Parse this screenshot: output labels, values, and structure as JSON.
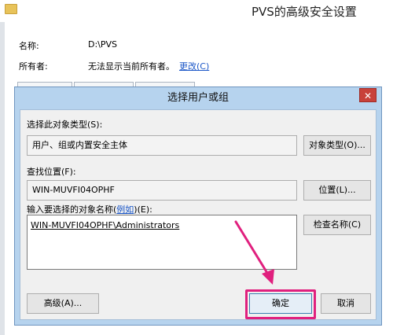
{
  "background_window": {
    "title": "PVS的高级安全设置",
    "name_label": "名称:",
    "name_value": "D:\\PVS",
    "owner_label": "所有者:",
    "owner_value": "无法显示当前所有者。",
    "change_link": "更改(C)"
  },
  "dialog": {
    "title": "选择用户或组",
    "close_glyph": "✕",
    "object_type_label": "选择此对象类型(S):",
    "object_type_value": "用户、组或内置安全主体",
    "object_type_button": "对象类型(O)...",
    "location_label": "查找位置(F):",
    "location_value": "WIN-MUVFI04OPHF",
    "location_button": "位置(L)...",
    "names_label_prefix": "输入要选择的对象名称(",
    "names_label_link": "例如",
    "names_label_suffix": ")(E):",
    "names_value": "WIN-MUVFI04OPHF\\Administrators",
    "check_names_button": "检查名称(C)",
    "advanced_button": "高级(A)...",
    "ok_button": "确定",
    "cancel_button": "取消"
  },
  "colors": {
    "dialog_frame": "#b6d3ee",
    "close_button": "#c8413a",
    "highlight": "#e0207e",
    "link": "#1a56c7"
  }
}
